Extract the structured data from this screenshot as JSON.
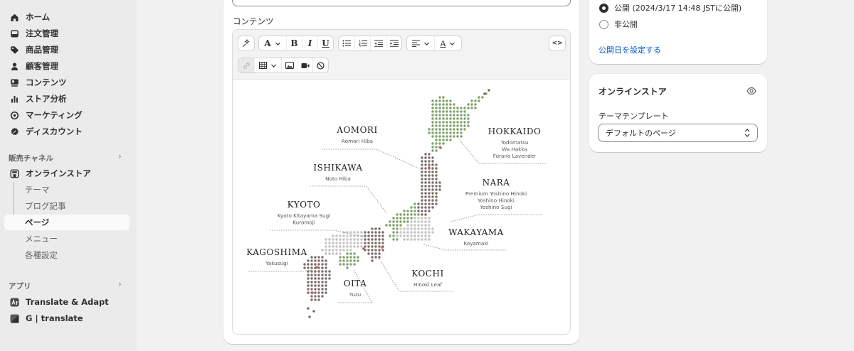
{
  "sidebar": {
    "nav": [
      {
        "label": "ホーム",
        "icon": "home-icon"
      },
      {
        "label": "注文管理",
        "icon": "inbox-icon"
      },
      {
        "label": "商品管理",
        "icon": "tag-icon"
      },
      {
        "label": "顧客管理",
        "icon": "person-icon"
      },
      {
        "label": "コンテンツ",
        "icon": "content-icon"
      },
      {
        "label": "ストア分析",
        "icon": "bar-chart-icon"
      },
      {
        "label": "マーケティング",
        "icon": "target-icon"
      },
      {
        "label": "ディスカウント",
        "icon": "discount-icon"
      }
    ],
    "sales_channels": {
      "label": "販売チャネル",
      "online_store": "オンラインストア",
      "sub": [
        "テーマ",
        "ブログ記事",
        "ページ",
        "メニュー",
        "各種設定"
      ]
    },
    "apps": {
      "label": "アプリ",
      "items": [
        "Translate & Adapt",
        "G | translate"
      ]
    }
  },
  "editor": {
    "content_label": "コンテンツ",
    "map": {
      "regions": [
        {
          "name": "AOMORI",
          "species": [
            "Aomori Hiba"
          ]
        },
        {
          "name": "HOKKAIDO",
          "species": [
            "Todomatsu",
            "Wa Hakka",
            "Furano Lavender"
          ]
        },
        {
          "name": "ISHIKAWA",
          "species": [
            "Noto Hiba"
          ]
        },
        {
          "name": "NARA",
          "species": [
            "Premium Yoshino Hinoki",
            "Yoshino Hinoki",
            "Yoshino Sugi"
          ]
        },
        {
          "name": "KYOTO",
          "species": [
            "Kyoto Kitayama Sugi",
            "Kuromoji"
          ]
        },
        {
          "name": "WAKAYAMA",
          "species": [
            "Koyamaki"
          ]
        },
        {
          "name": "KAGOSHIMA",
          "species": [
            "Yakusugi"
          ]
        },
        {
          "name": "KOCHI",
          "species": [
            "Hinoki Leaf"
          ]
        },
        {
          "name": "OITA",
          "species": [
            "Yuzu"
          ]
        }
      ],
      "colors": {
        "green": "#7ea36a",
        "brown": "#7b6c68",
        "gray": "#c4c4c4",
        "red": "#c9565a"
      }
    }
  },
  "visibility": {
    "published": "公開 (2024/3/17 14:48 JSTに公開)",
    "unpublished": "非公開",
    "set_date_link": "公開日を設定する"
  },
  "online_store": {
    "title": "オンラインストア",
    "template_label": "テーマテンプレート",
    "template_value": "デフォルトのページ"
  }
}
